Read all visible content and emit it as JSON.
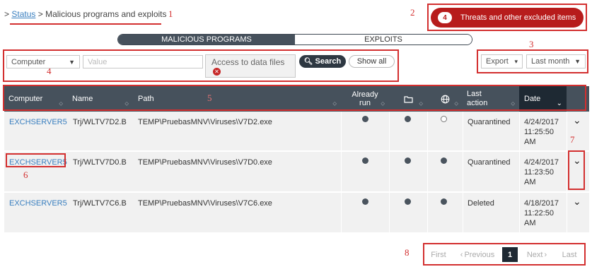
{
  "breadcrumb": {
    "prefix": ">",
    "link": "Status",
    "separator": ">",
    "current": "Malicious programs and exploits"
  },
  "threats_button": {
    "count": "4",
    "label": "Threats and other excluded items"
  },
  "tabs": {
    "malware": "MALICIOUS PROGRAMS",
    "exploits": "EXPLOITS"
  },
  "filter": {
    "field_select": "Computer",
    "value_placeholder": "Value",
    "tag": "Access to data files",
    "search": "Search",
    "show_all": "Show all"
  },
  "toolbar": {
    "export": "Export",
    "period": "Last month"
  },
  "table": {
    "headers": {
      "computer": "Computer",
      "name": "Name",
      "path": "Path",
      "already_run": "Already run",
      "last_action": "Last action",
      "date": "Date"
    },
    "rows": [
      {
        "computer": "EXCHSERVER5",
        "name": "Trj/WLTV7D2.B",
        "path": "TEMP\\PruebasMNV\\Viruses\\V7D2.exe",
        "action": "Quarantined",
        "date": "4/24/2017 11:25:50 AM"
      },
      {
        "computer": "EXCHSERVER5",
        "name": "Trj/WLTV7D0.B",
        "path": "TEMP\\PruebasMNV\\Viruses\\V7D0.exe",
        "action": "Quarantined",
        "date": "4/24/2017 11:23:50 AM"
      },
      {
        "computer": "EXCHSERVER5",
        "name": "Trj/WLTV7C6.B",
        "path": "TEMP\\PruebasMNV\\Viruses\\V7C6.exe",
        "action": "Deleted",
        "date": "4/18/2017 11:22:50 AM"
      }
    ]
  },
  "pagination": {
    "first": "First",
    "previous": "Previous",
    "page": "1",
    "next": "Next",
    "last": "Last"
  },
  "annotations": [
    "1",
    "2",
    "3",
    "4",
    "5",
    "6",
    "7",
    "8"
  ],
  "colors": {
    "accent_red": "#b71c1c",
    "header_dark": "#46515c",
    "link_blue": "#3a7fbf"
  }
}
